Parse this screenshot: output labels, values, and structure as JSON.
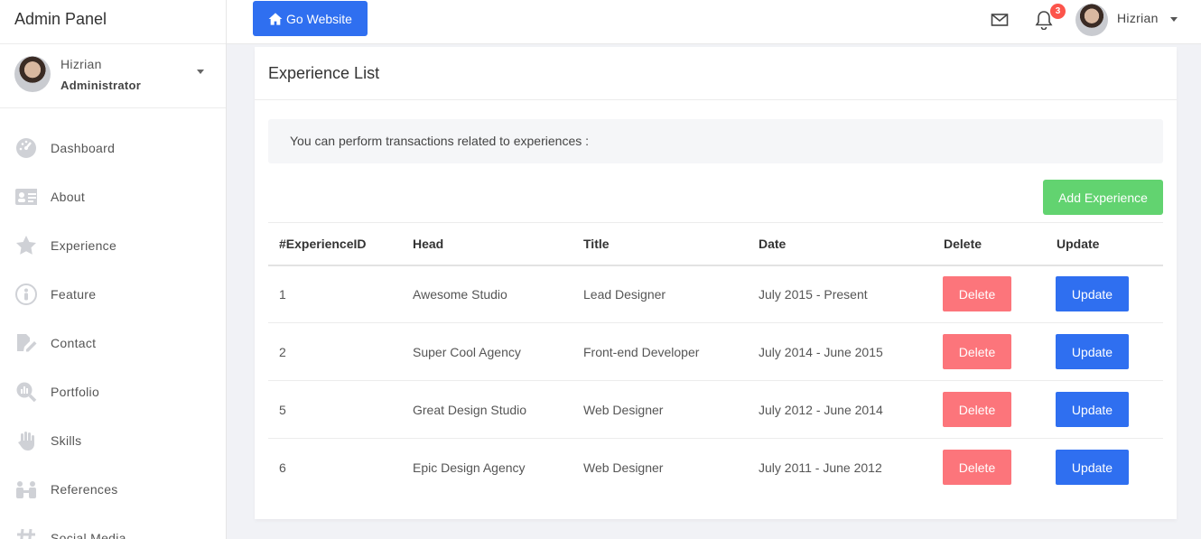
{
  "app": {
    "title": "Admin Panel"
  },
  "user": {
    "name": "Hizrian",
    "role": "Administrator"
  },
  "sidebar": {
    "items": [
      {
        "label": "Dashboard",
        "icon": "dashboard-icon"
      },
      {
        "label": "About",
        "icon": "id-card-icon"
      },
      {
        "label": "Experience",
        "icon": "star-icon"
      },
      {
        "label": "Feature",
        "icon": "feature-icon"
      },
      {
        "label": "Contact",
        "icon": "contact-edit-icon"
      },
      {
        "label": "Portfolio",
        "icon": "portfolio-search-icon"
      },
      {
        "label": "Skills",
        "icon": "hand-icon"
      },
      {
        "label": "References",
        "icon": "people-icon"
      },
      {
        "label": "Social Media",
        "icon": "hashtag-icon"
      }
    ]
  },
  "topbar": {
    "go_website": "Go Website",
    "notification_count": "3",
    "user_name": "Hizrian"
  },
  "main": {
    "card_title": "Experience List",
    "info_text": "You can perform transactions related to experiences :",
    "add_button": "Add Experience",
    "table": {
      "headers": [
        "#ExperienceID",
        "Head",
        "Title",
        "Date",
        "Delete",
        "Update"
      ],
      "rows": [
        {
          "id": "1",
          "head": "Awesome Studio",
          "title": "Lead Designer",
          "date": "July 2015 - Present"
        },
        {
          "id": "2",
          "head": "Super Cool Agency",
          "title": "Front-end Developer",
          "date": "July 2014 - June 2015"
        },
        {
          "id": "5",
          "head": "Great Design Studio",
          "title": "Web Designer",
          "date": "July 2012 - June 2014"
        },
        {
          "id": "6",
          "head": "Epic Design Agency",
          "title": "Web Designer",
          "date": "July 2011 - June 2012"
        }
      ],
      "delete_label": "Delete",
      "update_label": "Update"
    }
  },
  "colors": {
    "primary": "#2f6ff0",
    "success": "#62d370",
    "danger": "#fc757b",
    "badge": "#fc544b"
  }
}
